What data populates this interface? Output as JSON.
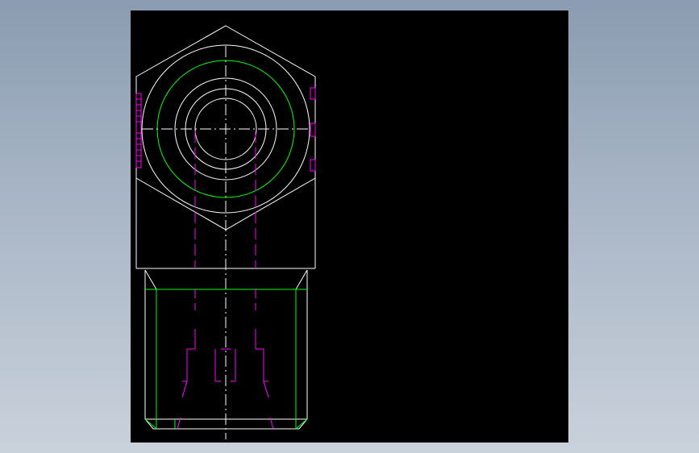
{
  "drawing": {
    "viewport_background": "#000000",
    "stroke_colors": {
      "outline": "#ffffff",
      "thread": "#00ff00",
      "hidden": "#ff00ff"
    },
    "views": [
      "top-view-hex",
      "front-view-section"
    ]
  }
}
